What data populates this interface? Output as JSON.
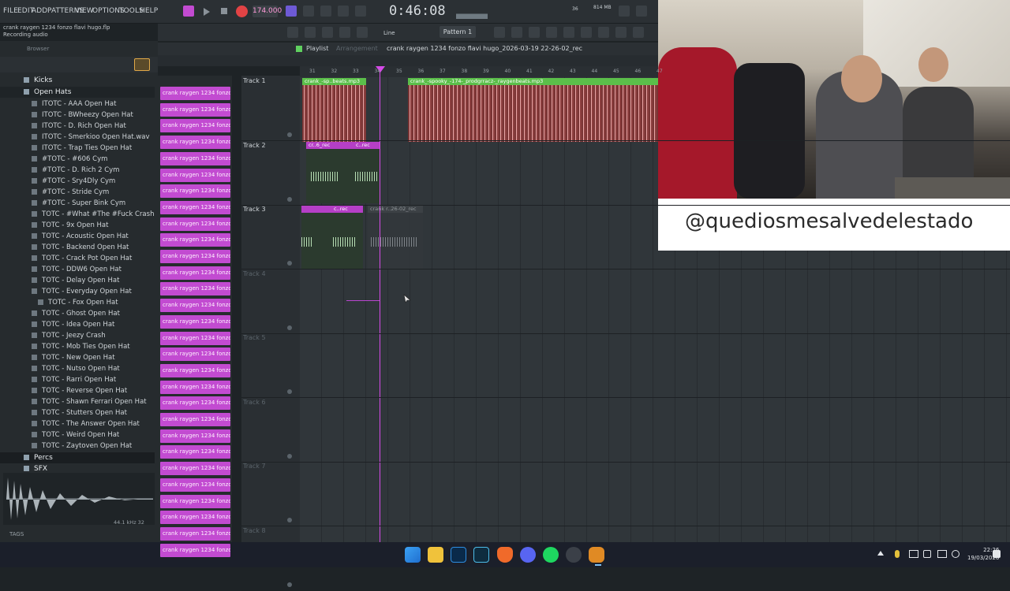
{
  "menu": [
    "FILE",
    "EDIT",
    "ADD",
    "PATTERNS",
    "VIEW",
    "OPTIONS",
    "TOOLS",
    "HELP"
  ],
  "bpm": "174.000",
  "time": "0:46:08",
  "hint_line1": "crank raygen 1234 fonzo flavi hugo.flp",
  "hint_line2": "Recording audio",
  "mem": "814 MB",
  "cpu": "36",
  "snap": "Line",
  "pattern": "Pattern 1",
  "browser_label": "Browser",
  "playlist": {
    "label": "Playlist",
    "sub": "Arrangement",
    "title": "crank raygen 1234 fonzo flavi hugo_2026-03-19 22-26-02_rec"
  },
  "browser": {
    "folders": [
      "Kicks",
      "Open Hats",
      "Percs",
      "SFX"
    ],
    "items": [
      "ITOTC - AAA Open Hat",
      "ITOTC - BWheezy Open Hat",
      "ITOTC - D. Rich Open Hat",
      "ITOTC - Smerkioo Open Hat.wav",
      "ITOTC - Trap Ties Open Hat",
      "#TOTC - #606 Cym",
      "#TOTC - D. Rich 2 Cym",
      "#TOTC - Sry4Dly Cym",
      "#TOTC - Stride Cym",
      "#TOTC - Super Bink Cym",
      "TOTC - #What #The #Fuck Crash",
      "TOTC - 9x Open Hat",
      "TOTC - Acoustic Open Hat",
      "TOTC - Backend Open Hat",
      "TOTC - Crack Pot Open Hat",
      "TOTC - DDW6 Open Hat",
      "TOTC - Delay Open Hat",
      "TOTC - Everyday Open Hat",
      "TOTC - Fox Open Hat",
      "TOTC - Ghost Open Hat",
      "TOTC - Idea Open Hat",
      "TOTC - Jeezy Crash",
      "TOTC - Mob Ties Open Hat",
      "TOTC - New Open Hat",
      "TOTC - Nutso Open Hat",
      "TOTC - Rarri Open Hat",
      "TOTC - Reverse Open Hat",
      "TOTC - Shawn Ferrari Open Hat",
      "TOTC - Stutters Open Hat",
      "TOTC - The Answer Open Hat",
      "TOTC - Weird Open Hat",
      "TOTC - Zaytoven Open Hat"
    ],
    "tags": "TAGS",
    "sample_info": "44.1 kHz 32"
  },
  "channel_label": "crank raygen 1234 fonzo...",
  "channel_count": 29,
  "ruler": [
    "31",
    "32",
    "33",
    "34",
    "35",
    "36",
    "37",
    "38",
    "39",
    "40",
    "41",
    "42",
    "43",
    "44",
    "45",
    "46",
    "47"
  ],
  "tracks": [
    "Track 1",
    "Track 2",
    "Track 3",
    "Track 4",
    "Track 5",
    "Track 6",
    "Track 7",
    "Track 8"
  ],
  "clips": {
    "t1a": "crank_-sp..beats.mp3",
    "t1b": "crank_-spooky_-174-_prodgrracz-_raygenbeats.mp3",
    "t2a": "cr..6_rec",
    "t2b": "c..rec",
    "t3b": "c..rec",
    "t3c": "crank r..26-02_rec"
  },
  "handle": "@quediosmesalvedelestado",
  "clock_time": "22:26",
  "clock_date": "19/03/2026"
}
